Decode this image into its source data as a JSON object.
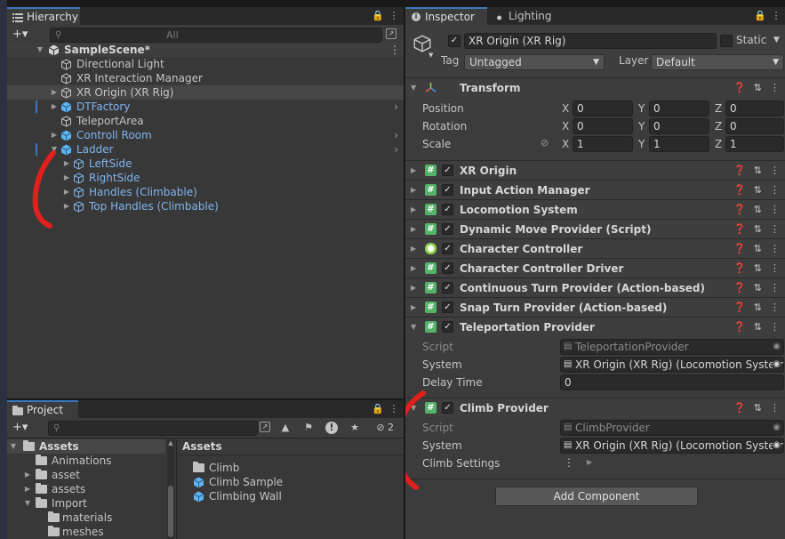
{
  "hierarchy": {
    "tab_label": "Hierarchy",
    "add_label": "+▾",
    "search_placeholder": "All",
    "scene_name": "SampleScene*",
    "items": [
      {
        "label": "Directional Light"
      },
      {
        "label": "XR Interaction Manager"
      },
      {
        "label": "XR Origin (XR Rig)"
      },
      {
        "label": "DTFactory"
      },
      {
        "label": "TeleportArea"
      },
      {
        "label": "Controll Room"
      },
      {
        "label": "Ladder"
      },
      {
        "label": "LeftSide"
      },
      {
        "label": "RightSide"
      },
      {
        "label": "Handles (Climbable)"
      },
      {
        "label": "Top Handles (Climbable)"
      }
    ]
  },
  "project": {
    "tab_label": "Project",
    "add_label": "+▾",
    "hidden_count": "2",
    "tree": [
      {
        "label": "Assets"
      },
      {
        "label": "Animations"
      },
      {
        "label": "asset"
      },
      {
        "label": "assets"
      },
      {
        "label": "Import"
      },
      {
        "label": "materials"
      },
      {
        "label": "meshes"
      }
    ],
    "breadcrumb": "Assets",
    "files": [
      {
        "label": "Climb"
      },
      {
        "label": "Climb Sample"
      },
      {
        "label": "Climbing Wall"
      }
    ]
  },
  "inspector": {
    "tab_inspector": "Inspector",
    "tab_lighting": "Lighting",
    "object_name": "XR Origin (XR Rig)",
    "static_label": "Static",
    "tag_label": "Tag",
    "tag_value": "Untagged",
    "layer_label": "Layer",
    "layer_value": "Default",
    "transform": {
      "title": "Transform",
      "position_label": "Position",
      "rotation_label": "Rotation",
      "scale_label": "Scale",
      "x": "X",
      "y": "Y",
      "z": "Z",
      "position": [
        "0",
        "0",
        "0"
      ],
      "rotation": [
        "0",
        "0",
        "0"
      ],
      "scale": [
        "1",
        "1",
        "1"
      ]
    },
    "components": [
      {
        "title": "XR Origin"
      },
      {
        "title": "Input Action Manager"
      },
      {
        "title": "Locomotion System"
      },
      {
        "title": "Dynamic Move Provider (Script)"
      },
      {
        "title": "Character Controller"
      },
      {
        "title": "Character Controller Driver"
      },
      {
        "title": "Continuous Turn Provider (Action-based)"
      },
      {
        "title": "Snap Turn Provider (Action-based)"
      }
    ],
    "teleport": {
      "title": "Teleportation Provider",
      "script_label": "Script",
      "script_value": "TeleportationProvider",
      "system_label": "System",
      "system_value": "XR Origin (XR Rig) (Locomotion System)",
      "delay_label": "Delay Time",
      "delay_value": "0"
    },
    "climb": {
      "title": "Climb Provider",
      "script_label": "Script",
      "script_value": "ClimbProvider",
      "system_label": "System",
      "system_value": "XR Origin (XR Rig) (Locomotion System)",
      "settings_label": "Climb Settings"
    },
    "add_component": "Add Component"
  },
  "colors": {
    "annotation": "#e0201c",
    "accent": "#3a79bb",
    "component_icon": "#55b26a"
  }
}
